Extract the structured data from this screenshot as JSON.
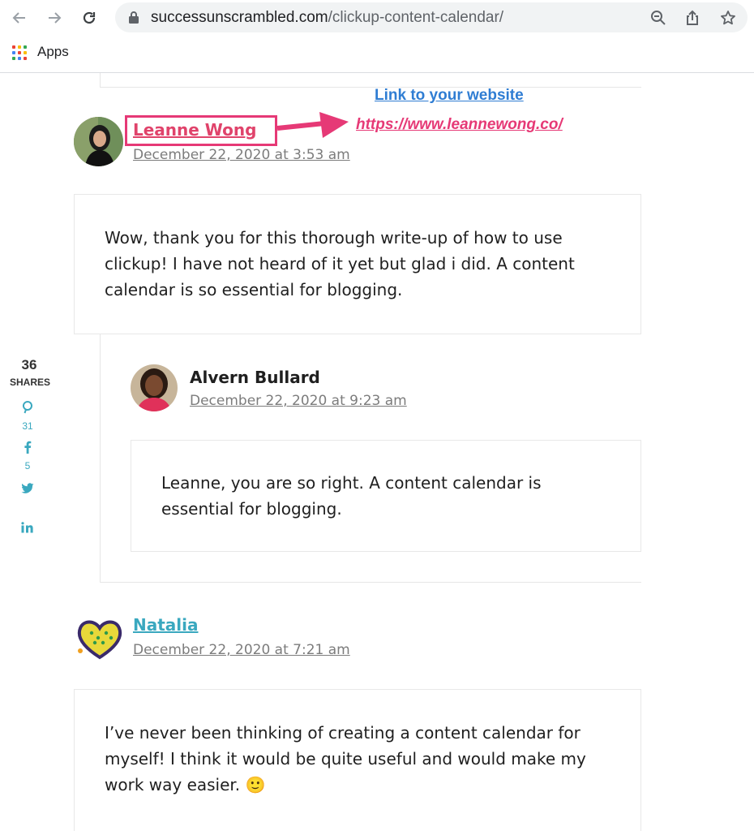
{
  "browser": {
    "url_host": "successunscrambled.com",
    "url_path": "/clickup-content-calendar/",
    "bookmarks_label": "Apps",
    "apps_colors": [
      "#ea4335",
      "#fbbc04",
      "#34a853",
      "#4285f4",
      "#ea4335",
      "#fbbc04",
      "#34a853",
      "#4285f4",
      "#ea4335"
    ]
  },
  "annotation": {
    "label": "Link to your website",
    "url": "https://www.leannewong.co/",
    "highlight_color": "#e63976"
  },
  "shares": {
    "count": "36",
    "label": "SHARES",
    "pinterest_count": "31",
    "facebook_count": "5"
  },
  "comments": [
    {
      "author": "Leanne Wong",
      "date": "December 22, 2020 at 3:53 am",
      "text": "Wow, thank you for this thorough write-up of how to use clickup! I have not heard of it yet but glad i did. A content calendar is so essential for blogging.",
      "author_color": "#e0436b"
    },
    {
      "author": "Alvern Bullard",
      "date": "December 22, 2020 at 9:23 am",
      "text": "Leanne, you are so right. A content calendar is essential for blogging."
    },
    {
      "author": "Natalia",
      "date": "December 22, 2020 at 7:21 am",
      "text": "I’ve never been thinking of creating a content calendar for myself! I think it would be quite useful and would make my work way easier. 🙂",
      "author_color": "#3aa8bf"
    }
  ]
}
